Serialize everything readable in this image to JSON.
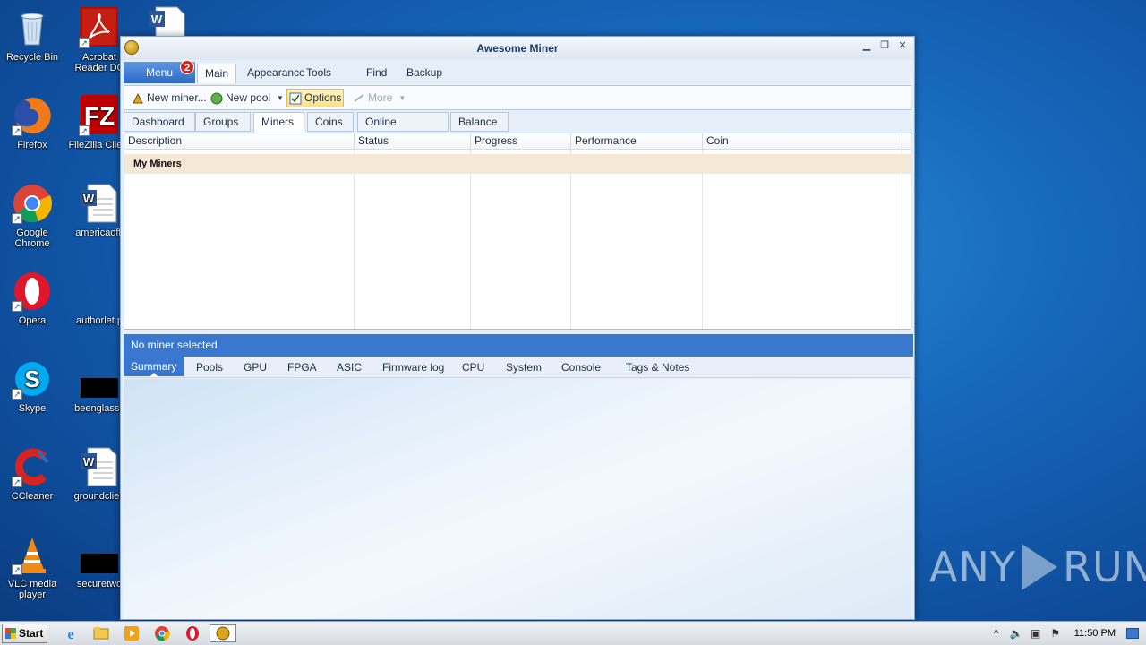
{
  "desktop": {
    "icons": [
      {
        "label": "Recycle Bin"
      },
      {
        "label": "Acrobat Reader DC"
      },
      {
        "label": "Firefox"
      },
      {
        "label": "FileZilla Client"
      },
      {
        "label": "Google Chrome"
      },
      {
        "label": "americaoffi"
      },
      {
        "label": "Opera"
      },
      {
        "label": "authorlet.p"
      },
      {
        "label": "Skype"
      },
      {
        "label": "beenglass.j"
      },
      {
        "label": "CCleaner"
      },
      {
        "label": "groundclien"
      },
      {
        "label": "VLC media player"
      },
      {
        "label": "securetwo"
      }
    ]
  },
  "window": {
    "title": "Awesome Miner",
    "menu_label": "Menu",
    "menu_badge": "2",
    "ribbon_tabs": [
      "Main",
      "Appearance",
      "Tools",
      "Find",
      "Backup"
    ],
    "toolbar": {
      "new_miner": "New miner...",
      "new_pool": "New pool",
      "options": "Options",
      "more": "More"
    },
    "subtabs": [
      "Dashboard",
      "Groups",
      "Miners",
      "Coins",
      "Online Services",
      "Balance"
    ],
    "grid": {
      "columns": [
        "Description",
        "Status",
        "Progress",
        "Performance",
        "Coin"
      ],
      "group_row": "My Miners"
    },
    "status_text": "No miner selected",
    "bottom_tabs": [
      "Summary",
      "Pools",
      "GPU",
      "FPGA",
      "ASIC",
      "Firmware log",
      "CPU",
      "System",
      "Console",
      "Tags & Notes"
    ]
  },
  "watermark": {
    "left": "ANY",
    "right": "RUN"
  },
  "taskbar": {
    "start_label": "Start",
    "clock": "11:50 PM"
  },
  "colors": {
    "accent": "#3a78cf",
    "group_row": "#f6e8d6",
    "badge": "#d0261e"
  }
}
